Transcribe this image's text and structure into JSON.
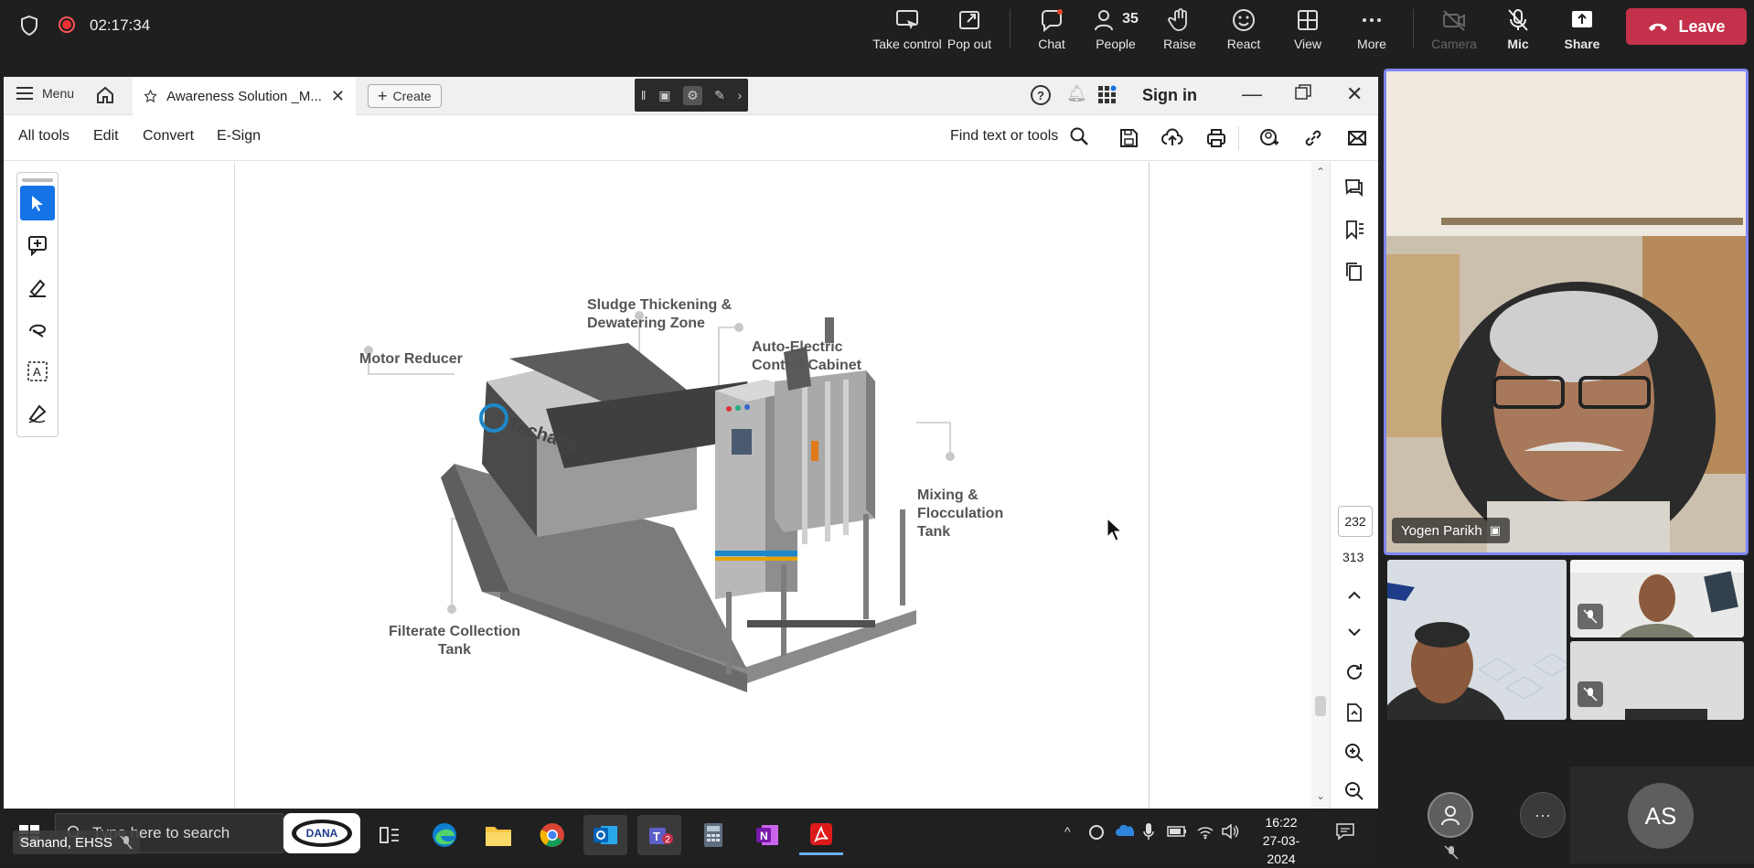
{
  "meeting": {
    "timer": "02:17:34",
    "buttons": {
      "take_control": "Take control",
      "pop_out": "Pop out",
      "chat": "Chat",
      "people": "People",
      "people_count": "35",
      "raise": "Raise",
      "react": "React",
      "view": "View",
      "more": "More",
      "camera": "Camera",
      "mic": "Mic",
      "share": "Share",
      "leave": "Leave"
    },
    "participants": {
      "main_speaker": "Yogen Parikh",
      "self_initials": "AS"
    },
    "colors": {
      "leave": "#c4314b",
      "active_border": "#7f85f5",
      "avatar": "#5e5e5e"
    }
  },
  "acrobat": {
    "menu": "Menu",
    "tab_title": "Awareness Solution _M...",
    "create": "Create",
    "sign_in": "Sign in",
    "toolbar": {
      "all_tools": "All tools",
      "edit": "Edit",
      "convert": "Convert",
      "esign": "E-Sign",
      "find": "Find text or tools"
    },
    "page_current": "232",
    "page_total": "313",
    "diagram": {
      "brand": "Techase",
      "labels": {
        "sludge": [
          "Sludge Thickening &",
          "Dewatering Zone"
        ],
        "auto": [
          "Auto-Electric",
          "Control Cabinet"
        ],
        "motor": [
          "Motor Reducer"
        ],
        "mixing": [
          "Mixing &",
          "Flocculation",
          "Tank"
        ],
        "filtrate": [
          "Filterate Collection",
          "Tank"
        ]
      }
    }
  },
  "taskbar": {
    "search_placeholder": "Type here to search",
    "time": "16:22",
    "date": "27-03-2024",
    "teams_badge": "2"
  },
  "overlay_label": "Sanand, EHSS"
}
